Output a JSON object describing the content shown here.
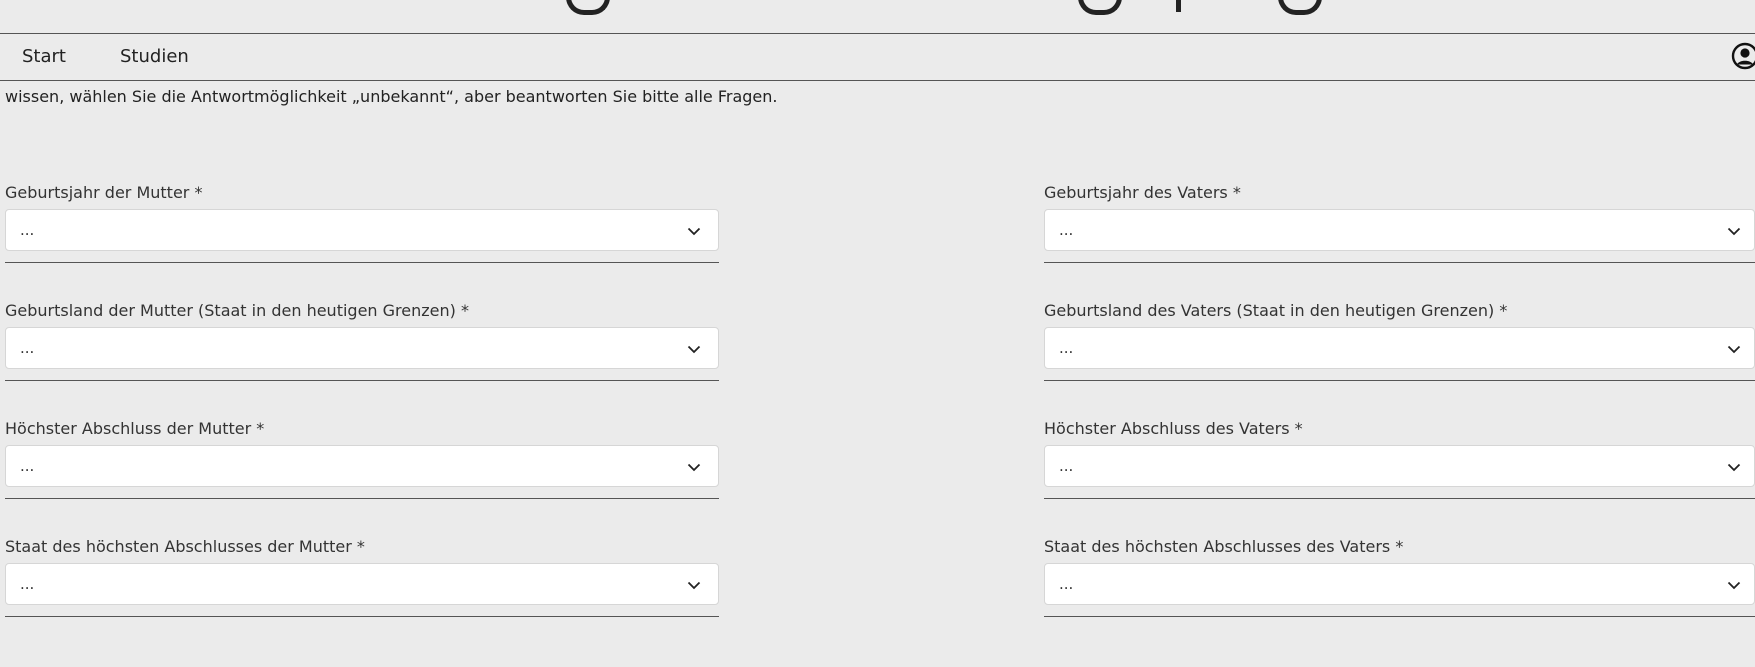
{
  "nav": {
    "items": [
      {
        "label": "Start"
      },
      {
        "label": "Studien"
      }
    ]
  },
  "intro_text": "wissen, wählen Sie die Antwortmöglichkeit „unbekannt“, aber beantworten Sie bitte alle Fragen.",
  "mother": {
    "birth_year": {
      "label": "Geburtsjahr der Mutter *",
      "value": "..."
    },
    "birth_country": {
      "label": "Geburtsland der Mutter (Staat in den heutigen Grenzen) *",
      "value": "..."
    },
    "highest_degree": {
      "label": "Höchster Abschluss der Mutter *",
      "value": "..."
    },
    "degree_country": {
      "label": "Staat des höchsten Abschlusses der Mutter *",
      "value": "..."
    }
  },
  "father": {
    "birth_year": {
      "label": "Geburtsjahr des Vaters *",
      "value": "..."
    },
    "birth_country": {
      "label": "Geburtsland des Vaters (Staat in den heutigen Grenzen) *",
      "value": "..."
    },
    "highest_degree": {
      "label": "Höchster Abschluss des Vaters *",
      "value": "..."
    },
    "degree_country": {
      "label": "Staat des höchsten Abschlusses des Vaters *",
      "value": "..."
    }
  },
  "icons": {
    "user": "user-circle-icon",
    "chevron": "chevron-down-icon"
  },
  "colors": {
    "background": "#ebebeb",
    "field_background": "#ffffff",
    "text": "#222222",
    "divider": "#555555"
  }
}
